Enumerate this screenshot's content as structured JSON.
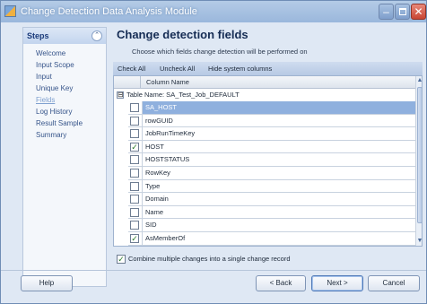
{
  "window": {
    "title": "Change Detection Data Analysis Module",
    "controls": {
      "minimize": "–",
      "close": "✕"
    }
  },
  "steps": {
    "title": "Steps",
    "collapse_glyph": "⌃",
    "items": [
      {
        "label": "Welcome"
      },
      {
        "label": "Input Scope"
      },
      {
        "label": "Input"
      },
      {
        "label": "Unique Key"
      },
      {
        "label": "Fields",
        "active": true
      },
      {
        "label": "Log History"
      },
      {
        "label": "Result Sample"
      },
      {
        "label": "Summary"
      }
    ]
  },
  "main": {
    "title": "Change detection fields",
    "subtitle": "Choose which fields change detection will be performed on"
  },
  "toolbar": {
    "check_all": "Check All",
    "uncheck_all": "Uncheck All",
    "hide_system": "Hide system columns"
  },
  "grid": {
    "column_header": "Column Name",
    "group_expander": "⊟",
    "group_label": "Table Name: SA_Test_Job_DEFAULT",
    "rows": [
      {
        "name": "SA_HOST",
        "checked": false,
        "selected": true
      },
      {
        "name": "rowGUID",
        "checked": false
      },
      {
        "name": "JobRunTimeKey",
        "checked": false
      },
      {
        "name": "HOST",
        "checked": true
      },
      {
        "name": "HOSTSTATUS",
        "checked": false
      },
      {
        "name": "RowKey",
        "checked": false
      },
      {
        "name": "Type",
        "checked": false
      },
      {
        "name": "Domain",
        "checked": false
      },
      {
        "name": "Name",
        "checked": false
      },
      {
        "name": "SID",
        "checked": false
      },
      {
        "name": "AsMemberOf",
        "checked": true
      }
    ],
    "check_glyph": "✓",
    "scroll_up": "▲",
    "scroll_down": "▼"
  },
  "options": {
    "combine_label": "Combine multiple changes into a single change record",
    "combine_checked": true
  },
  "buttons": {
    "help": "Help",
    "back": "< Back",
    "next": "Next >",
    "cancel": "Cancel"
  }
}
